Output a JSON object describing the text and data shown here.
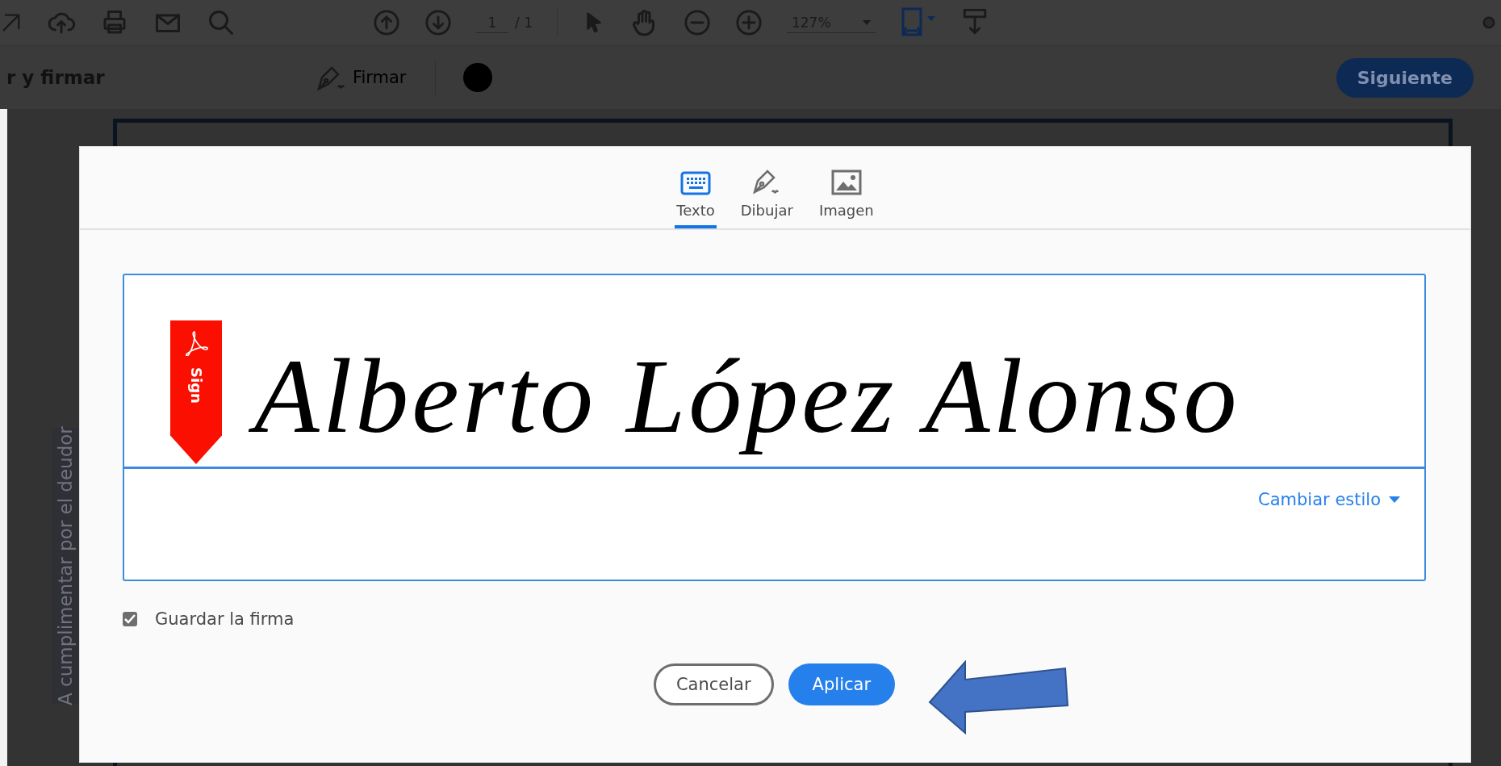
{
  "toolbar": {
    "page_current": "1",
    "page_total": "/ 1",
    "zoom": "127%"
  },
  "sign_bar": {
    "title": "r y firmar",
    "sign_tool": "Firmar",
    "next_button": "Siguiente"
  },
  "document": {
    "side_label": "A cumplimentar por el deudor"
  },
  "dialog": {
    "tabs": [
      {
        "label": "Texto",
        "selected": true
      },
      {
        "label": "Dibujar",
        "selected": false
      },
      {
        "label": "Imagen",
        "selected": false
      }
    ],
    "signature": {
      "badge": "Sign",
      "value": "Alberto López Alonso",
      "style_button": "Cambiar estilo"
    },
    "save_signature": {
      "label": "Guardar la firma",
      "checked": true
    },
    "buttons": [
      {
        "label": "Cancelar",
        "kind": "secondary"
      },
      {
        "label": "Aplicar",
        "kind": "primary"
      }
    ]
  }
}
